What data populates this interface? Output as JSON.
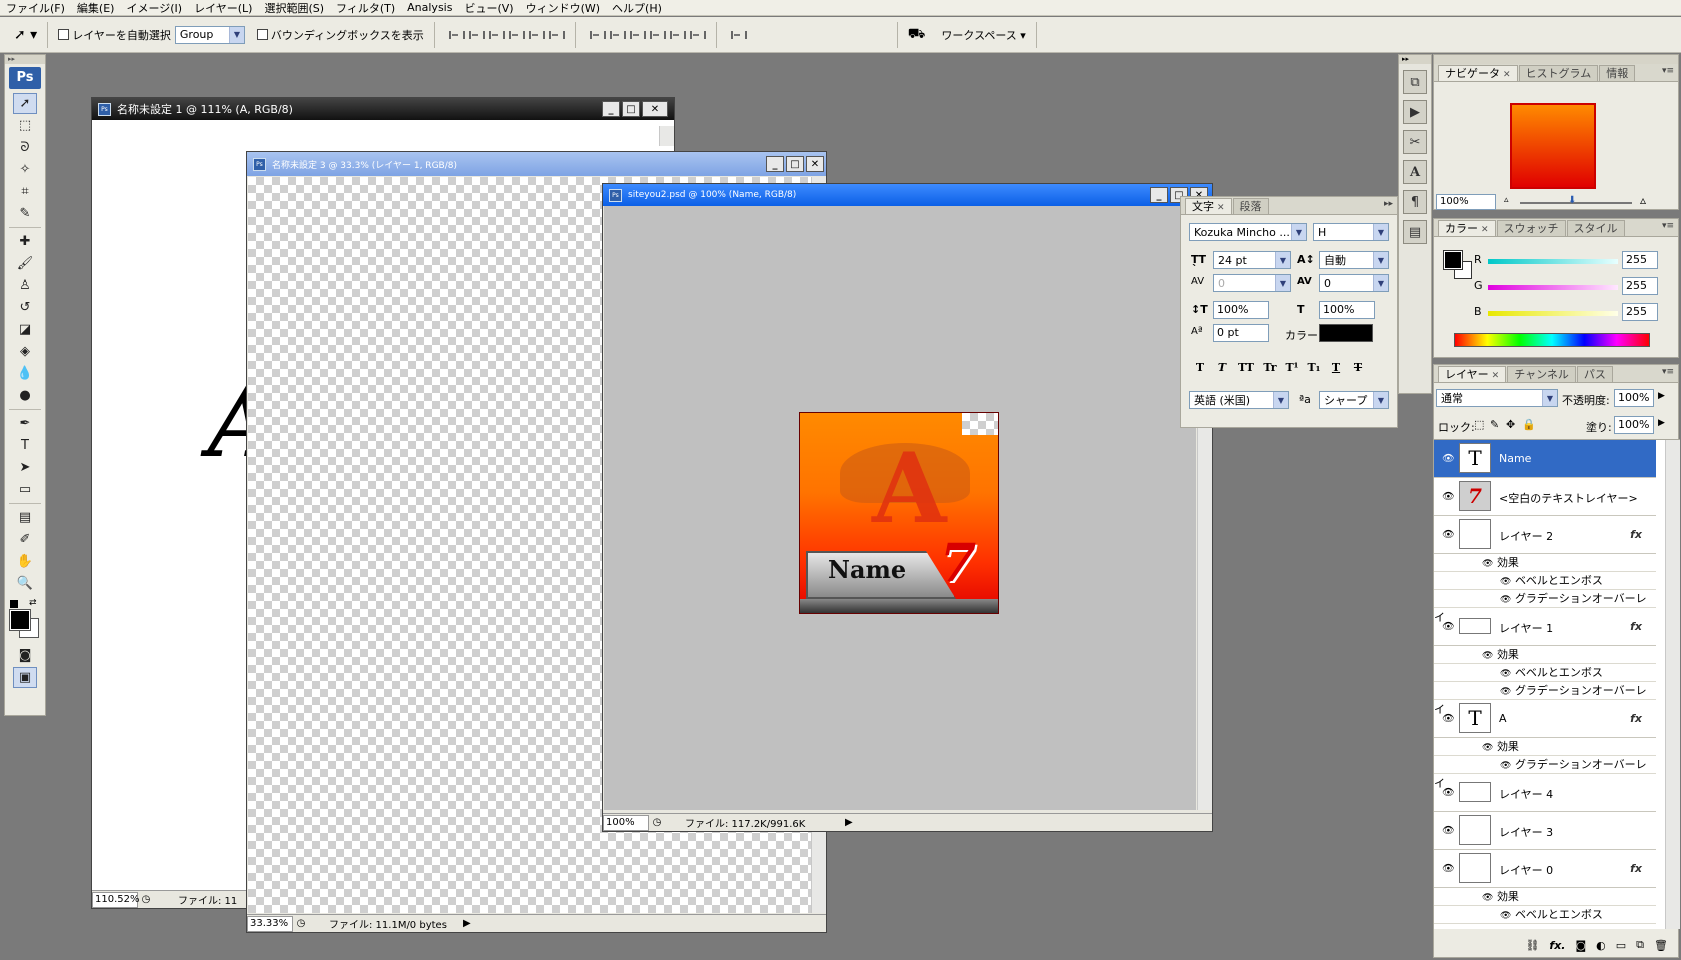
{
  "menu": [
    "ファイル(F)",
    "編集(E)",
    "イメージ(I)",
    "レイヤー(L)",
    "選択範囲(S)",
    "フィルタ(T)",
    "Analysis",
    "ビュー(V)",
    "ウィンドウ(W)",
    "ヘルプ(H)"
  ],
  "options": {
    "auto_select_label": "レイヤーを自動選択",
    "auto_select_value": "Group",
    "bbox_label": "バウンディングボックスを表示",
    "workspace_label": "ワークスペース ▾"
  },
  "toolbox": {
    "logo": "Ps"
  },
  "doc1": {
    "title": "名称未設定 1 @ 111% (A, RGB/8)",
    "zoom": "110.52%",
    "file": "ファイル: 11",
    "preview_char": "A"
  },
  "doc2": {
    "title": "名称未設定 3 @ 33.3% (レイヤー 1, RGB/8)",
    "zoom": "33.33%",
    "file": "ファイル: 11.1M/0 bytes"
  },
  "doc3": {
    "title": "siteyou2.psd @ 100% (Name, RGB/8)",
    "zoom": "100%",
    "file": "ファイル: 117.2K/991.6K",
    "artwork": {
      "big_letter": "A",
      "name_text": "Name",
      "seven": "7"
    }
  },
  "character_panel": {
    "tabs": [
      "文字",
      "段落"
    ],
    "font_family": "Kozuka Mincho ...",
    "font_style": "H",
    "size": "24 pt",
    "leading": "自動",
    "kerning": "0",
    "tracking": "0",
    "vscale": "100%",
    "hscale": "100%",
    "baseline": "0 pt",
    "color_label": "カラー:",
    "style_buttons": [
      "T",
      "T",
      "TT",
      "Tr",
      "T¹",
      "T₁",
      "T",
      "T"
    ],
    "language": "英語 (米国)",
    "antialias_label": "ªa",
    "antialias": "シャープ"
  },
  "navigator_panel": {
    "tabs": [
      "ナビゲータ",
      "ヒストグラム",
      "情報"
    ],
    "zoom": "100%"
  },
  "color_panel": {
    "tabs": [
      "カラー",
      "スウォッチ",
      "スタイル"
    ],
    "channels": [
      {
        "label": "R",
        "value": "255",
        "color": "#00c8c8"
      },
      {
        "label": "G",
        "value": "255",
        "color": "#e000e0"
      },
      {
        "label": "B",
        "value": "255",
        "color": "#e8e800"
      }
    ]
  },
  "layers_panel": {
    "tabs": [
      "レイヤー",
      "チャンネル",
      "パス"
    ],
    "blend_mode": "通常",
    "opacity_label": "不透明度:",
    "opacity": "100%",
    "lock_label": "ロック:",
    "fill_label": "塗り:",
    "fill": "100%",
    "layers": [
      {
        "name": "Name",
        "thumb": "T",
        "selected": true
      },
      {
        "name": "<空白のテキストレイヤー>",
        "thumb": "7"
      },
      {
        "name": "レイヤー 2",
        "fx": "fx",
        "effects_label": "効果",
        "effects": [
          "ベベルとエンボス",
          "グラデーションオーバーレイ"
        ]
      },
      {
        "name": "レイヤー 1",
        "fx": "fx",
        "effects_label": "効果",
        "effects": [
          "ベベルとエンボス",
          "グラデーションオーバーレイ"
        ]
      },
      {
        "name": "A",
        "thumb": "T",
        "fx": "fx",
        "effects_label": "効果",
        "effects": [
          "グラデーションオーバーレイ"
        ]
      },
      {
        "name": "レイヤー 4"
      },
      {
        "name": "レイヤー 3"
      },
      {
        "name": "レイヤー 0",
        "fx": "fx",
        "effects_label": "効果",
        "effects": [
          "ベベルとエンボス"
        ]
      }
    ]
  }
}
